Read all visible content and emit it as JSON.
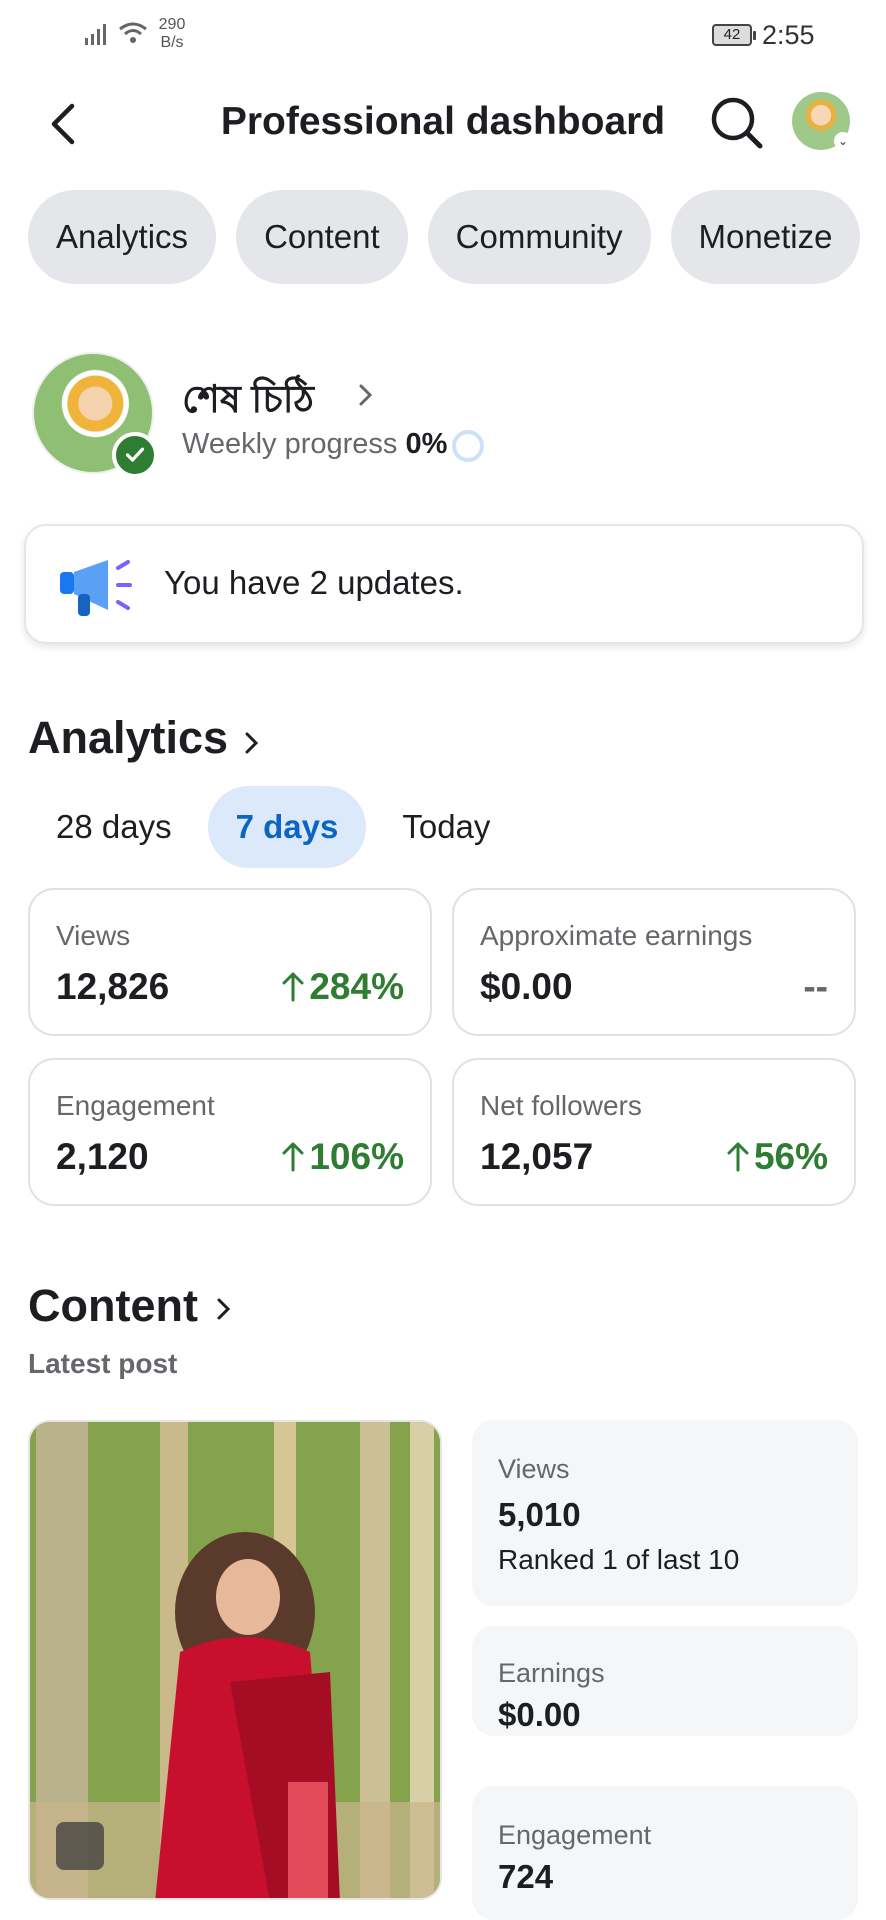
{
  "status_bar": {
    "net_speed": "290\nB/s",
    "battery": "42",
    "time": "2:55"
  },
  "header": {
    "title": "Professional dashboard"
  },
  "tabs": [
    {
      "label": "Analytics"
    },
    {
      "label": "Content"
    },
    {
      "label": "Community"
    },
    {
      "label": "Monetize"
    }
  ],
  "profile": {
    "name": "শেষ চিঠি",
    "weekly_label": "Weekly progress",
    "weekly_value": "0%",
    "weekly_fraction": 0
  },
  "updates": {
    "text": "You have 2 updates."
  },
  "analytics": {
    "title": "Analytics",
    "ranges": [
      {
        "label": "28 days",
        "active": false
      },
      {
        "label": "7 days",
        "active": true
      },
      {
        "label": "Today",
        "active": false
      }
    ],
    "stats": [
      {
        "label": "Views",
        "value": "12,826",
        "change": "284%",
        "trend": "up"
      },
      {
        "label": "Approximate earnings",
        "value": "$0.00",
        "change": "--",
        "trend": "none"
      },
      {
        "label": "Engagement",
        "value": "2,120",
        "change": "106%",
        "trend": "up"
      },
      {
        "label": "Net followers",
        "value": "12,057",
        "change": "56%",
        "trend": "up"
      }
    ]
  },
  "content": {
    "title": "Content",
    "latest_label": "Latest post",
    "metrics": {
      "views_label": "Views",
      "views_value": "5,010",
      "views_rank": "Ranked 1 of last 10",
      "earnings_label": "Earnings",
      "earnings_value": "$0.00",
      "engagement_label": "Engagement",
      "engagement_value": "724"
    }
  },
  "colors": {
    "accent": "#0a66c2",
    "positive": "#2e7d32",
    "chip_bg": "#e4e6e9",
    "active_chip_bg": "#dbe9fb"
  }
}
